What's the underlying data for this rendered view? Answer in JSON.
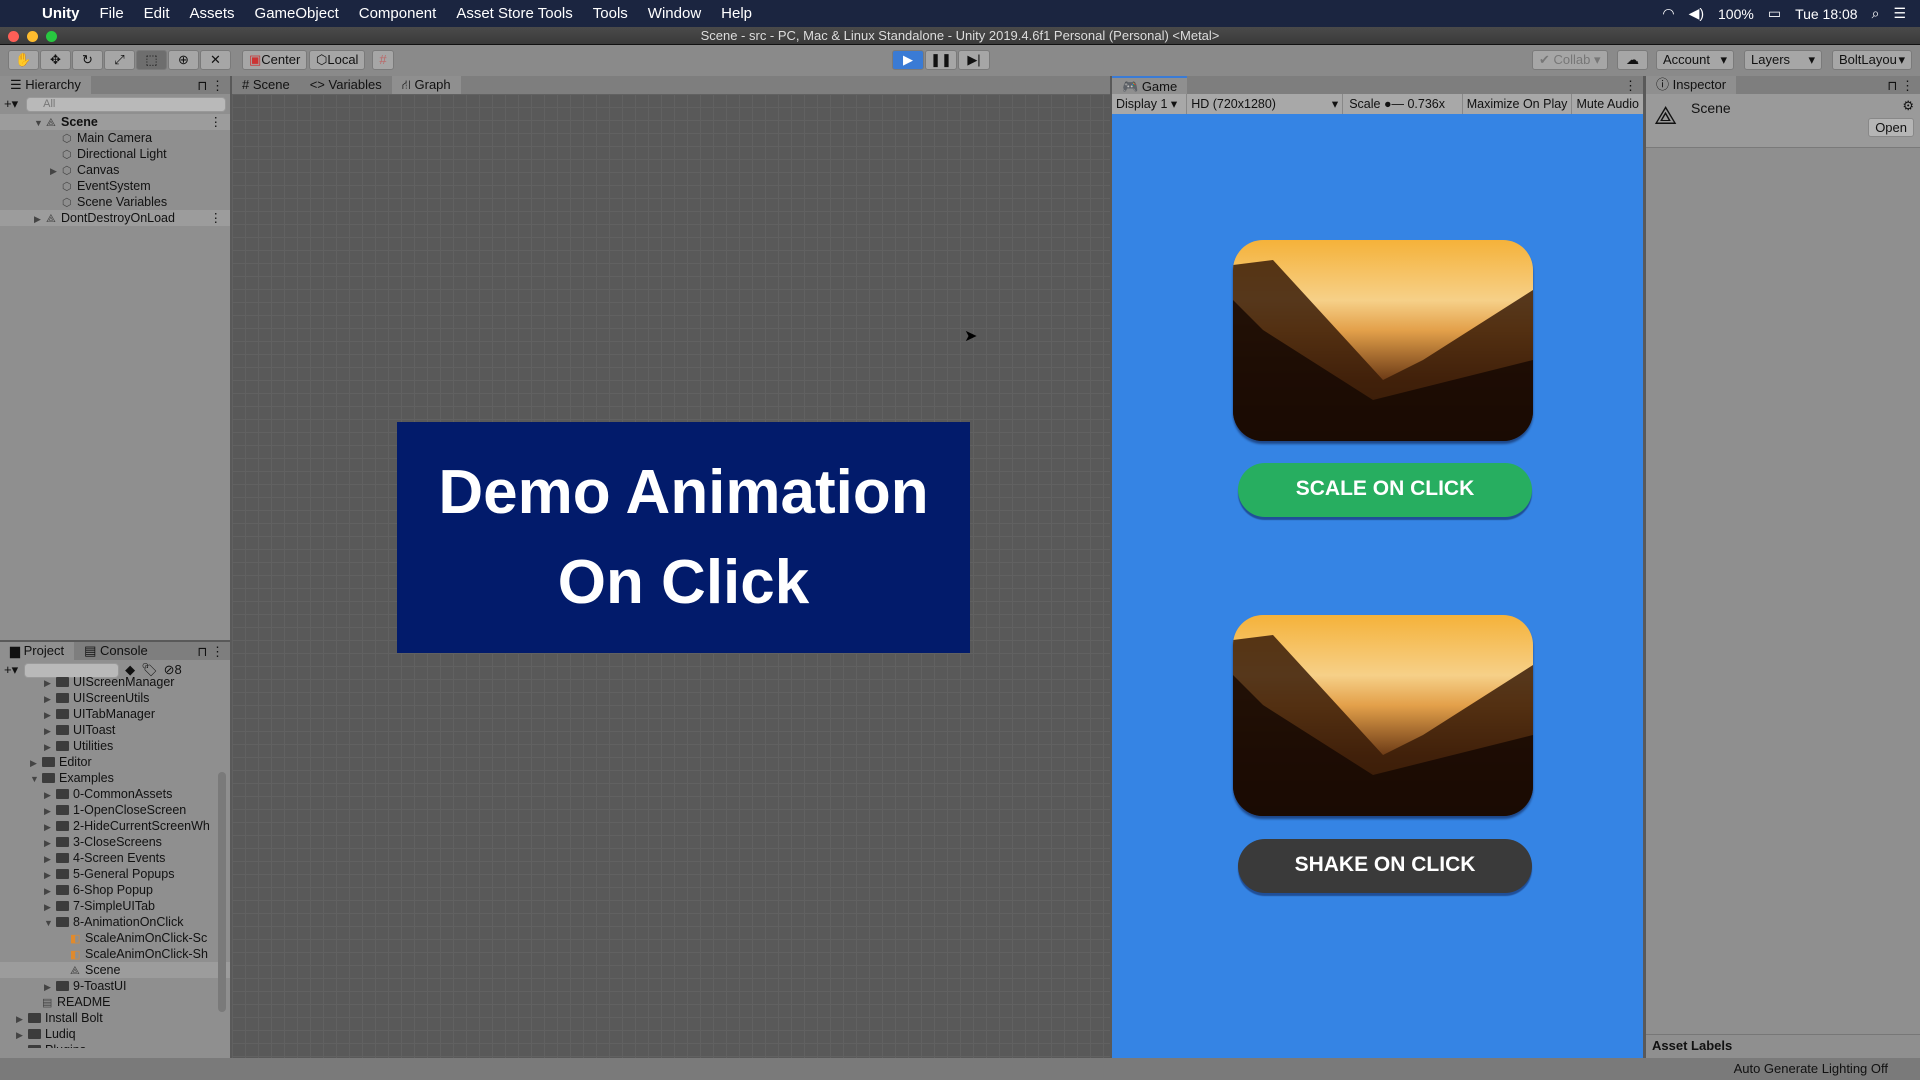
{
  "menubar": {
    "app": "Unity",
    "items": [
      "File",
      "Edit",
      "Assets",
      "GameObject",
      "Component",
      "Asset Store Tools",
      "Tools",
      "Window",
      "Help"
    ],
    "battery": "100%",
    "clock": "Tue 18:08"
  },
  "window": {
    "title": "Scene - src - PC, Mac & Linux Standalone - Unity 2019.4.6f1 Personal (Personal) <Metal>"
  },
  "toolbar": {
    "pivot": "Center",
    "space": "Local",
    "collab": "Collab",
    "account": "Account",
    "layers": "Layers",
    "layout": "BoltLayou"
  },
  "hierarchy": {
    "tab": "Hierarchy",
    "search_placeholder": "All",
    "items": [
      {
        "label": "Scene",
        "depth": 0,
        "expanded": true,
        "kind": "scene",
        "bold": true
      },
      {
        "label": "Main Camera",
        "depth": 1,
        "kind": "go"
      },
      {
        "label": "Directional Light",
        "depth": 1,
        "kind": "go"
      },
      {
        "label": "Canvas",
        "depth": 1,
        "kind": "go",
        "collapsed": true
      },
      {
        "label": "EventSystem",
        "depth": 1,
        "kind": "go"
      },
      {
        "label": "Scene Variables",
        "depth": 1,
        "kind": "go"
      },
      {
        "label": "DontDestroyOnLoad",
        "depth": 0,
        "kind": "scene",
        "collapsed": true
      }
    ]
  },
  "center_tabs": [
    "Scene",
    "Variables",
    "Graph"
  ],
  "scene": {
    "line1": "Demo Animation",
    "line2": "On Click"
  },
  "project": {
    "tabs": [
      "Project",
      "Console"
    ],
    "hidden_count": "8",
    "items": [
      {
        "label": "UIScreenManager",
        "depth": 2,
        "kind": "folder"
      },
      {
        "label": "UIScreenUtils",
        "depth": 2,
        "kind": "folder"
      },
      {
        "label": "UITabManager",
        "depth": 2,
        "kind": "folder"
      },
      {
        "label": "UIToast",
        "depth": 2,
        "kind": "folder"
      },
      {
        "label": "Utilities",
        "depth": 2,
        "kind": "folder"
      },
      {
        "label": "Editor",
        "depth": 1,
        "kind": "folder"
      },
      {
        "label": "Examples",
        "depth": 1,
        "kind": "folder",
        "expanded": true
      },
      {
        "label": "0-CommonAssets",
        "depth": 2,
        "kind": "folder"
      },
      {
        "label": "1-OpenCloseScreen",
        "depth": 2,
        "kind": "folder"
      },
      {
        "label": "2-HideCurrentScreenWh",
        "depth": 2,
        "kind": "folder"
      },
      {
        "label": "3-CloseScreens",
        "depth": 2,
        "kind": "folder"
      },
      {
        "label": "4-Screen Events",
        "depth": 2,
        "kind": "folder"
      },
      {
        "label": "5-General Popups",
        "depth": 2,
        "kind": "folder"
      },
      {
        "label": "6-Shop Popup",
        "depth": 2,
        "kind": "folder"
      },
      {
        "label": "7-SimpleUITab",
        "depth": 2,
        "kind": "folder"
      },
      {
        "label": "8-AnimationOnClick",
        "depth": 2,
        "kind": "folder",
        "expanded": true
      },
      {
        "label": "ScaleAnimOnClick-Sc",
        "depth": 3,
        "kind": "prefab"
      },
      {
        "label": "ScaleAnimOnClick-Sh",
        "depth": 3,
        "kind": "prefab"
      },
      {
        "label": "Scene",
        "depth": 3,
        "kind": "scene",
        "selected": true
      },
      {
        "label": "9-ToastUI",
        "depth": 2,
        "kind": "folder"
      },
      {
        "label": "README",
        "depth": 1,
        "kind": "doc"
      },
      {
        "label": "Install Bolt",
        "depth": 0,
        "kind": "folder"
      },
      {
        "label": "Ludiq",
        "depth": 0,
        "kind": "folder"
      },
      {
        "label": "Plugins",
        "depth": 0,
        "kind": "folder"
      }
    ]
  },
  "game": {
    "tab": "Game",
    "display": "Display 1",
    "resolution": "HD (720x1280)",
    "scale_label": "Scale",
    "scale_value": "0.736x",
    "maximize": "Maximize On Play",
    "mute": "Mute Audio",
    "button1": "SCALE ON CLICK",
    "button2": "SHAKE ON CLICK",
    "colors": {
      "bg": "#3584e4",
      "button1": "#27ae60",
      "button2": "#3a3a3a"
    }
  },
  "inspector": {
    "tab": "Inspector",
    "object": "Scene",
    "open": "Open",
    "asset_labels": "Asset Labels"
  },
  "status": {
    "text": "Auto Generate Lighting Off"
  }
}
